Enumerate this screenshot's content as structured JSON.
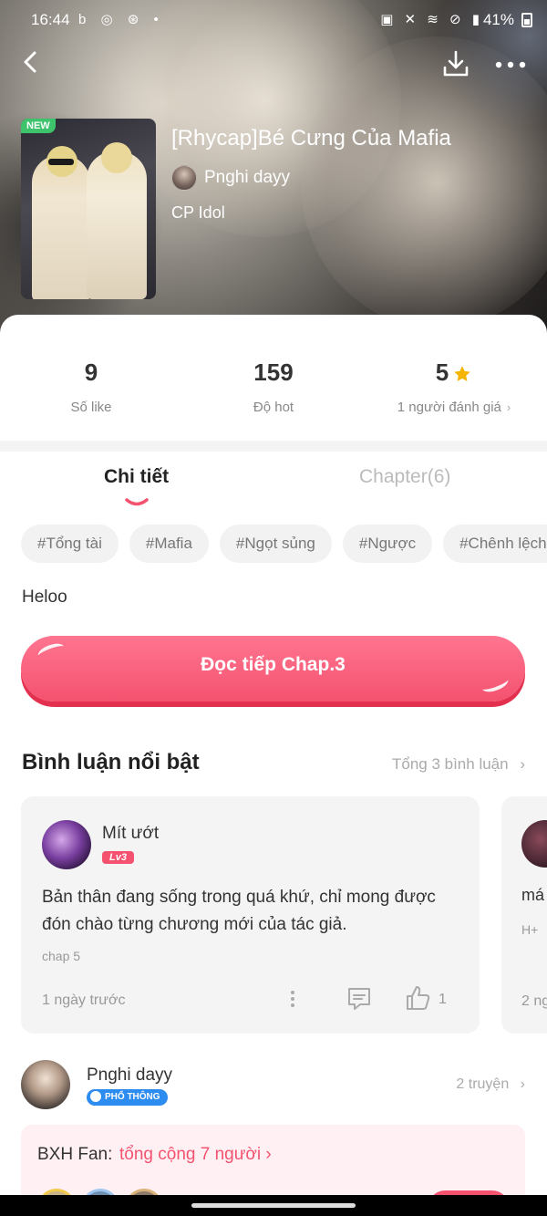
{
  "status_bar": {
    "time": "16:44",
    "battery": "41%"
  },
  "header": {
    "new_badge": "NEW",
    "title": "[Rhycap]Bé Cưng Của Mafia",
    "author": "Pnghi dayy",
    "category": "CP Idol"
  },
  "stats": [
    {
      "value": "9",
      "label": "Số like"
    },
    {
      "value": "159",
      "label": "Độ hot"
    },
    {
      "value": "5",
      "label": "1 người đánh giá",
      "icon": "star-icon"
    }
  ],
  "tabs": [
    {
      "label": "Chi tiết",
      "active": true
    },
    {
      "label": "Chapter(6)",
      "active": false
    }
  ],
  "tags": [
    "#Tổng tài",
    "#Mafia",
    "#Ngọt sủng",
    "#Ngược",
    "#Chênh lệch"
  ],
  "description": "Heloo",
  "read_button": "Đọc tiếp Chap.3",
  "comments": {
    "title": "Bình luận nổi bật",
    "total": "Tổng 3 bình luận",
    "featured": {
      "name": "Mít ướt",
      "level": "Lv3",
      "text": "Bản thân đang sống trong quá khứ, chỉ mong được đón chào từng chương mới của tác giả.",
      "chapter": "chap 5",
      "time": "1 ngày trước",
      "likes": "1"
    },
    "peek": {
      "text": "má",
      "sub": "H+",
      "time": "2 ng"
    }
  },
  "author_card": {
    "name": "Pnghi dayy",
    "badge": "PHỔ THÔNG",
    "stories": "2 truyện"
  },
  "fan_rank": {
    "label": "BXH Fan:",
    "count": "tổng cộng 7 người"
  },
  "colors": {
    "accent": "#f4526f",
    "star": "#f5b400",
    "badge_blue": "#2d8cf0"
  }
}
